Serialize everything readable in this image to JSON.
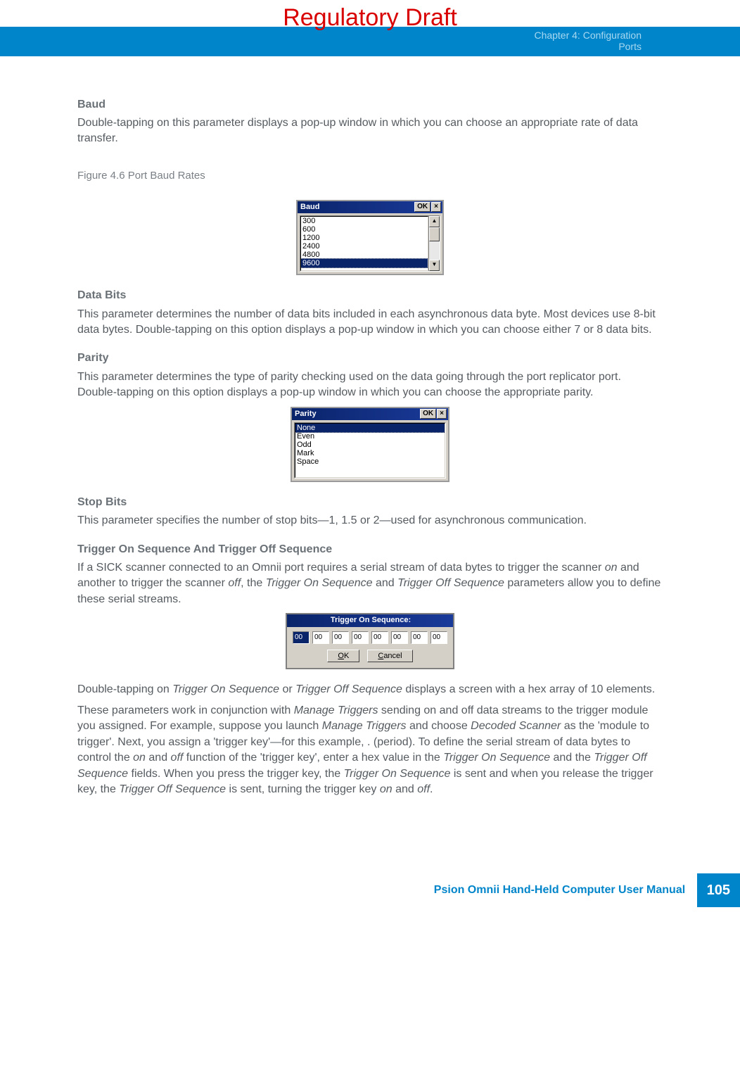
{
  "draft_banner": "Regulatory Draft",
  "header": {
    "chapter": "Chapter 4:  Configuration",
    "section": "Ports"
  },
  "sections": {
    "baud": {
      "heading": "Baud",
      "text": "Double-tapping on this parameter displays a pop-up window in which you can choose an appropriate rate of data transfer."
    },
    "figure_caption": "Figure 4.6    Port Baud Rates",
    "baud_dialog": {
      "title": "Baud",
      "ok": "OK",
      "close": "×",
      "items": [
        "300",
        "600",
        "1200",
        "2400",
        "4800",
        "9600"
      ],
      "selected": "9600"
    },
    "databits": {
      "heading": "Data Bits",
      "text": "This parameter determines the number of data bits included in each asynchronous data byte. Most devices use 8-bit data bytes. Double-tapping on this option displays a pop-up window in which you can choose either 7 or 8 data bits."
    },
    "parity": {
      "heading": "Parity",
      "text": "This parameter determines the type of parity checking used on the data going through the port replicator port. Double-tapping on this option displays a pop-up window in which you can choose the appropriate parity."
    },
    "parity_dialog": {
      "title": "Parity",
      "ok": "OK",
      "close": "×",
      "items": [
        "None",
        "Even",
        "Odd",
        "Mark",
        "Space"
      ],
      "selected": "None"
    },
    "stopbits": {
      "heading": "Stop Bits",
      "text": "This parameter specifies the number of stop bits—1, 1.5 or 2—used for asynchronous communication."
    },
    "trigger": {
      "heading": "Trigger On Sequence And Trigger Off Sequence",
      "text1_a": "If a SICK scanner connected to an Omnii port requires a serial stream of data bytes to trigger the scanner ",
      "text1_b": "on",
      "text1_c": " and another to trigger the scanner ",
      "text1_d": "off",
      "text1_e": ", the ",
      "text1_f": "Trigger On Sequence",
      "text1_g": " and ",
      "text1_h": "Trigger Off Sequence",
      "text1_i": " parameters allow you to define these serial streams."
    },
    "trigger_dialog": {
      "title": "Trigger On Sequence:",
      "values": [
        "00",
        "00",
        "00",
        "00",
        "00",
        "00",
        "00",
        "00"
      ],
      "ok": "OK",
      "cancel": "Cancel"
    },
    "trigger_after": {
      "p1_a": "Double-tapping on ",
      "p1_b": "Trigger On Sequence",
      "p1_c": " or ",
      "p1_d": "Trigger Off Sequence",
      "p1_e": " displays a screen with a hex array of 10 elements.",
      "p2_a": "These parameters work in conjunction with ",
      "p2_b": "Manage Triggers",
      "p2_c": " sending on and off data streams to the trigger module you assigned. For example, suppose you launch ",
      "p2_d": "Manage Triggers",
      "p2_e": " and choose ",
      "p2_f": "Decoded Scanner",
      "p2_g": " as the 'module to trigger'. Next, you assign a 'trigger key'—for this example, . (period). To define the serial stream of data bytes to control the ",
      "p2_h": "on",
      "p2_i": " and ",
      "p2_j": "off",
      "p2_k": " function of the 'trigger key', enter a hex value in the ",
      "p2_l": "Trigger On Sequence",
      "p2_m": " and the ",
      "p2_n": "Trigger Off Sequence",
      "p2_o": " fields. When you press the trigger key, the ",
      "p2_p": "Trigger On Sequence",
      "p2_q": " is sent and when you release the trigger key, the ",
      "p2_r": "Trigger Off Sequence",
      "p2_s": " is sent, turning the trigger key ",
      "p2_t": "on",
      "p2_u": " and ",
      "p2_v": "off",
      "p2_w": "."
    }
  },
  "footer": {
    "text": "Psion Omnii Hand-Held Computer User Manual",
    "page": "105"
  }
}
